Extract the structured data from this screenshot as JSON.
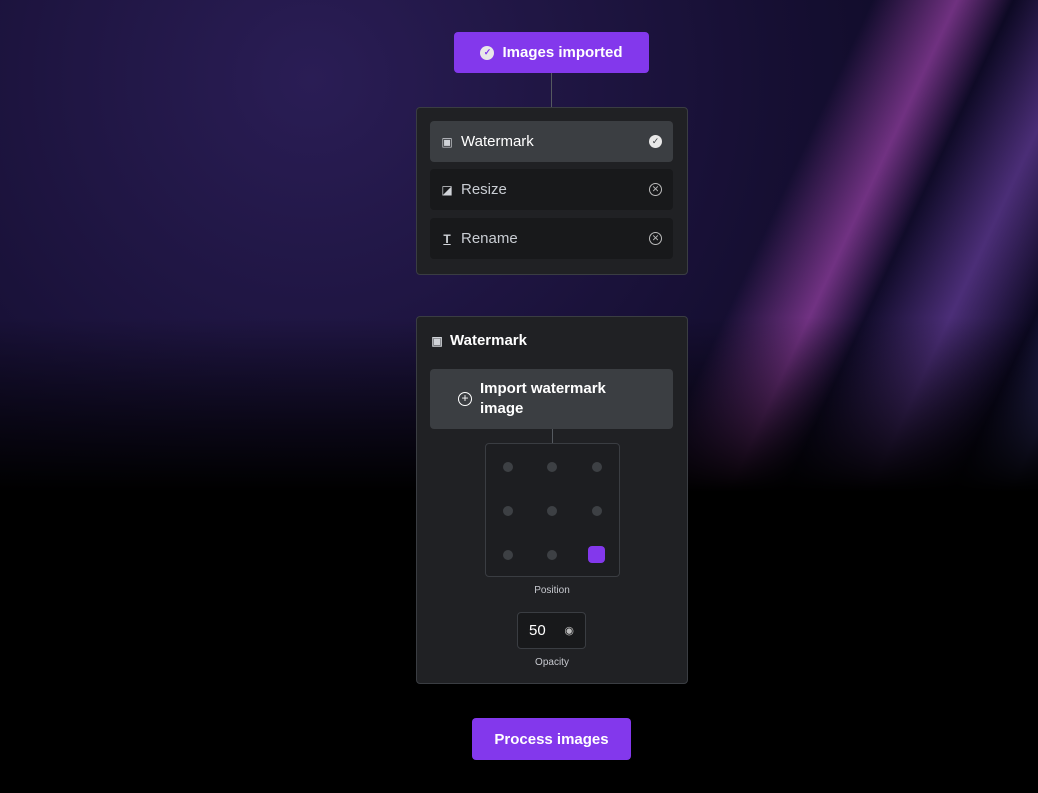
{
  "top_button": {
    "label": "Images imported",
    "icon": "check-circle-icon"
  },
  "operations": [
    {
      "label": "Watermark",
      "icon": "watermark-icon",
      "status": "enabled",
      "active": true
    },
    {
      "label": "Resize",
      "icon": "resize-icon",
      "status": "disabled",
      "active": false
    },
    {
      "label": "Rename",
      "icon": "text-icon",
      "status": "disabled",
      "active": false
    }
  ],
  "watermark": {
    "title": "Watermark",
    "import_label": "Import watermark image",
    "position_label": "Position",
    "position_selected": "bottom-right",
    "opacity_value": "50",
    "opacity_label": "Opacity"
  },
  "process_button": {
    "label": "Process images"
  },
  "colors": {
    "accent": "#8338ec",
    "panel": "#202124"
  }
}
